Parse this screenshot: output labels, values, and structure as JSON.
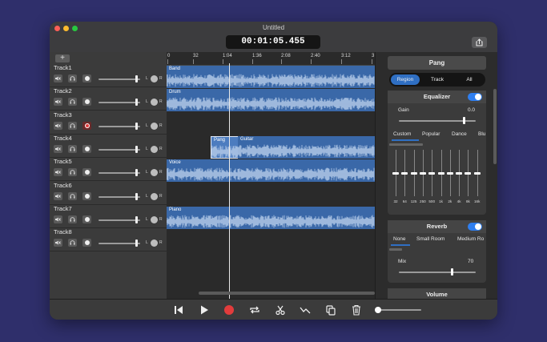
{
  "window": {
    "title": "Untitled",
    "time": "00:01:05.455",
    "lights": [
      "#ff5f57",
      "#febc2e",
      "#28c840"
    ]
  },
  "tracks": {
    "add_label": "+",
    "items": [
      {
        "name": "Track1",
        "armed": false
      },
      {
        "name": "Track2",
        "armed": false
      },
      {
        "name": "Track3",
        "armed": true
      },
      {
        "name": "Track4",
        "armed": false
      },
      {
        "name": "Track5",
        "armed": false
      },
      {
        "name": "Track6",
        "armed": false
      },
      {
        "name": "Track7",
        "armed": false
      },
      {
        "name": "Track8",
        "armed": false
      }
    ],
    "pan_left": "L",
    "pan_right": "R"
  },
  "timeline": {
    "ruler": [
      "0",
      "32",
      "1:04",
      "1:36",
      "2:08",
      "2:40",
      "3:12",
      "3"
    ],
    "regions": [
      {
        "label": "Band",
        "lane": 0
      },
      {
        "label": "Drum",
        "lane": 1
      },
      {
        "label": "Pang",
        "lane": 3
      },
      {
        "label": "Guitar",
        "lane": 3
      },
      {
        "label": "Voice",
        "lane": 4
      },
      {
        "label": "Piano",
        "lane": 6
      }
    ],
    "region_color": "#3a68a8"
  },
  "panel": {
    "title": "Pang",
    "scope": [
      "Region",
      "Track",
      "All"
    ],
    "scope_selected": "Region",
    "equalizer": {
      "title": "Equalizer",
      "enabled": true,
      "gain_label": "Gain",
      "gain_value": "0.0",
      "presets": [
        "Custom",
        "Popular",
        "Dance",
        "Blu"
      ],
      "selected_preset": "Custom",
      "bands": [
        "32",
        "64",
        "125",
        "250",
        "500",
        "1k",
        "2k",
        "4k",
        "8k",
        "16k"
      ]
    },
    "reverb": {
      "title": "Reverb",
      "enabled": true,
      "presets": [
        "None",
        "Small Room",
        "Medium Ro"
      ],
      "selected_preset": "None",
      "mix_label": "Mix",
      "mix_value": "70"
    },
    "volume": {
      "title": "Volume"
    }
  },
  "toolbar": {
    "items": [
      "skip-back",
      "play",
      "record",
      "loop",
      "cut",
      "automation",
      "duplicate",
      "delete"
    ],
    "accent": "#e23c3c"
  }
}
